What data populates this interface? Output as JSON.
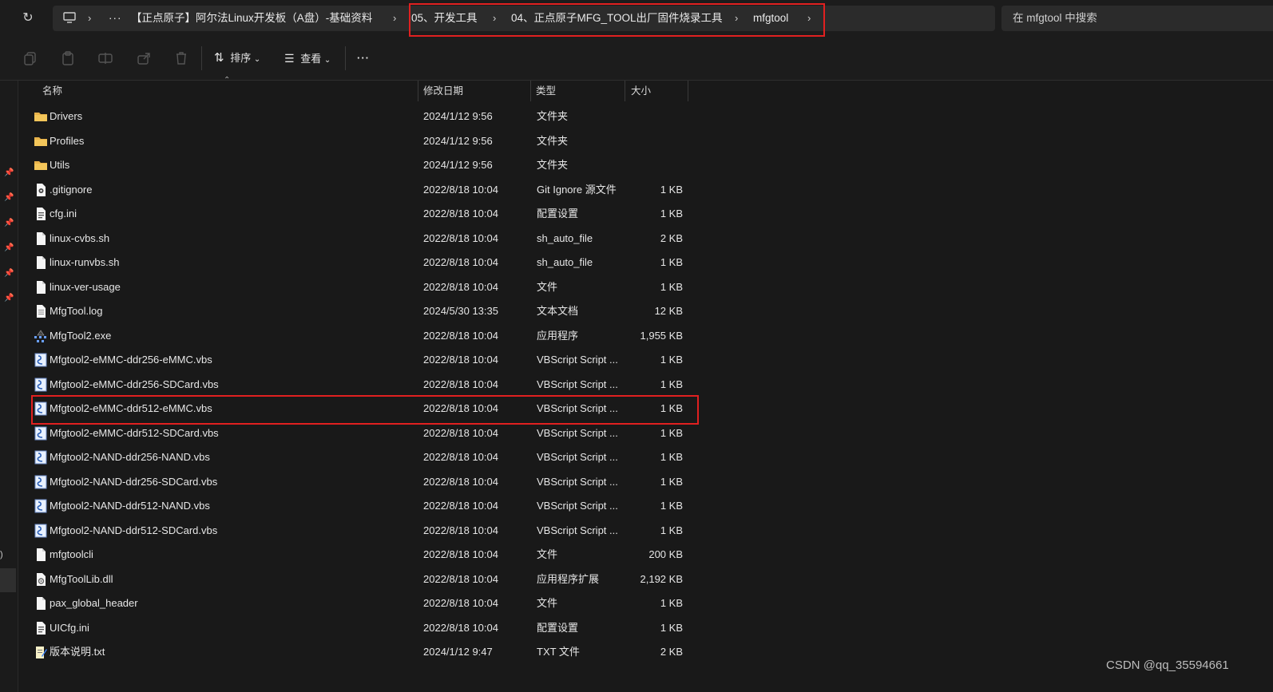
{
  "address": {
    "overflow": "···",
    "crumbs": [
      "【正点原子】阿尔法Linux开发板（A盘）-基础资料",
      "05、开发工具",
      "04、正点原子MFG_TOOL出厂固件烧录工具",
      "mfgtool"
    ]
  },
  "search": {
    "placeholder": "在 mfgtool 中搜索"
  },
  "toolbar": {
    "sort_label": "排序",
    "view_label": "查看",
    "more": "···"
  },
  "columns": {
    "name": "名称",
    "date": "修改日期",
    "type": "类型",
    "size": "大小"
  },
  "files": [
    {
      "name": "Drivers",
      "date": "2024/1/12 9:56",
      "type": "文件夹",
      "size": "",
      "icon": "folder-icon"
    },
    {
      "name": "Profiles",
      "date": "2024/1/12 9:56",
      "type": "文件夹",
      "size": "",
      "icon": "folder-icon"
    },
    {
      "name": "Utils",
      "date": "2024/1/12 9:56",
      "type": "文件夹",
      "size": "",
      "icon": "folder-icon"
    },
    {
      "name": ".gitignore",
      "date": "2022/8/18 10:04",
      "type": "Git Ignore 源文件",
      "size": "1 KB",
      "icon": "gitignore-file-icon"
    },
    {
      "name": "cfg.ini",
      "date": "2022/8/18 10:04",
      "type": "配置设置",
      "size": "1 KB",
      "icon": "settings-file-icon"
    },
    {
      "name": "linux-cvbs.sh",
      "date": "2022/8/18 10:04",
      "type": "sh_auto_file",
      "size": "2 KB",
      "icon": "file-icon"
    },
    {
      "name": "linux-runvbs.sh",
      "date": "2022/8/18 10:04",
      "type": "sh_auto_file",
      "size": "1 KB",
      "icon": "file-icon"
    },
    {
      "name": "linux-ver-usage",
      "date": "2022/8/18 10:04",
      "type": "文件",
      "size": "1 KB",
      "icon": "file-icon"
    },
    {
      "name": "MfgTool.log",
      "date": "2024/5/30 13:35",
      "type": "文本文档",
      "size": "12 KB",
      "icon": "text-file-icon"
    },
    {
      "name": "MfgTool2.exe",
      "date": "2022/8/18 10:04",
      "type": "应用程序",
      "size": "1,955 KB",
      "icon": "exe-icon"
    },
    {
      "name": "Mfgtool2-eMMC-ddr256-eMMC.vbs",
      "date": "2022/8/18 10:04",
      "type": "VBScript Script ...",
      "size": "1 KB",
      "icon": "vbs-script-icon"
    },
    {
      "name": "Mfgtool2-eMMC-ddr256-SDCard.vbs",
      "date": "2022/8/18 10:04",
      "type": "VBScript Script ...",
      "size": "1 KB",
      "icon": "vbs-script-icon"
    },
    {
      "name": "Mfgtool2-eMMC-ddr512-eMMC.vbs",
      "date": "2022/8/18 10:04",
      "type": "VBScript Script ...",
      "size": "1 KB",
      "icon": "vbs-script-icon"
    },
    {
      "name": "Mfgtool2-eMMC-ddr512-SDCard.vbs",
      "date": "2022/8/18 10:04",
      "type": "VBScript Script ...",
      "size": "1 KB",
      "icon": "vbs-script-icon"
    },
    {
      "name": "Mfgtool2-NAND-ddr256-NAND.vbs",
      "date": "2022/8/18 10:04",
      "type": "VBScript Script ...",
      "size": "1 KB",
      "icon": "vbs-script-icon"
    },
    {
      "name": "Mfgtool2-NAND-ddr256-SDCard.vbs",
      "date": "2022/8/18 10:04",
      "type": "VBScript Script ...",
      "size": "1 KB",
      "icon": "vbs-script-icon"
    },
    {
      "name": "Mfgtool2-NAND-ddr512-NAND.vbs",
      "date": "2022/8/18 10:04",
      "type": "VBScript Script ...",
      "size": "1 KB",
      "icon": "vbs-script-icon"
    },
    {
      "name": "Mfgtool2-NAND-ddr512-SDCard.vbs",
      "date": "2022/8/18 10:04",
      "type": "VBScript Script ...",
      "size": "1 KB",
      "icon": "vbs-script-icon"
    },
    {
      "name": "mfgtoolcli",
      "date": "2022/8/18 10:04",
      "type": "文件",
      "size": "200 KB",
      "icon": "file-icon"
    },
    {
      "name": "MfgToolLib.dll",
      "date": "2022/8/18 10:04",
      "type": "应用程序扩展",
      "size": "2,192 KB",
      "icon": "dll-file-icon"
    },
    {
      "name": "pax_global_header",
      "date": "2022/8/18 10:04",
      "type": "文件",
      "size": "1 KB",
      "icon": "file-icon"
    },
    {
      "name": "UICfg.ini",
      "date": "2022/8/18 10:04",
      "type": "配置设置",
      "size": "1 KB",
      "icon": "settings-file-icon"
    },
    {
      "name": "版本说明.txt",
      "date": "2024/1/12 9:47",
      "type": "TXT 文件",
      "size": "2 KB",
      "icon": "txt-file-icon"
    }
  ],
  "highlight_color": "#e02020",
  "watermark": "CSDN @qq_35594661"
}
